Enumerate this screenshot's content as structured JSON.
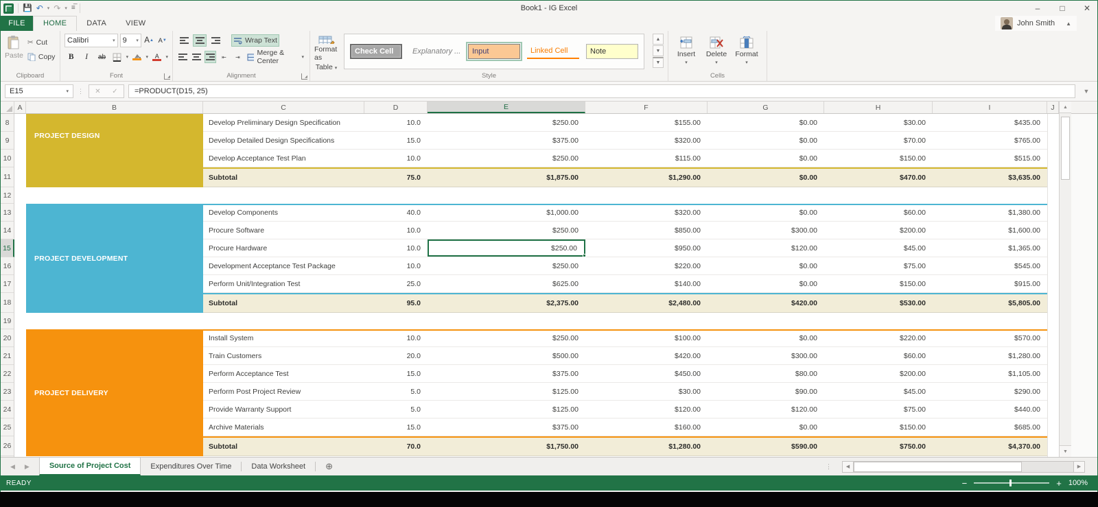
{
  "colors": {
    "accent": "#217346",
    "design": "#d4b72e",
    "development": "#4db5d2",
    "delivery": "#f6920e",
    "subtotal_bg": "#f2edd8"
  },
  "titlebar": {
    "title": "Book1 - IG Excel"
  },
  "tabs": {
    "file": "FILE",
    "items": [
      "HOME",
      "DATA",
      "VIEW"
    ],
    "active": "HOME",
    "user": "John Smith"
  },
  "ribbon": {
    "clipboard": {
      "label": "Clipboard",
      "paste": "Paste",
      "cut": "Cut",
      "copy": "Copy"
    },
    "font": {
      "label": "Font",
      "family": "Calibri",
      "size": "9",
      "bold": "B",
      "italic": "I",
      "strike": "ab"
    },
    "alignment": {
      "label": "Alignment",
      "wrap_text": "Wrap Text",
      "merge_center": "Merge & Center"
    },
    "style": {
      "label": "Style",
      "format_as_table_1": "Format as",
      "format_as_table_2": "Table",
      "gallery": [
        "Check Cell",
        "Explanatory ...",
        "Input",
        "Linked Cell",
        "Note"
      ]
    },
    "cells": {
      "label": "Cells",
      "insert": "Insert",
      "delete": "Delete",
      "format": "Format"
    }
  },
  "formula_bar": {
    "name_box": "E15",
    "formula": "=PRODUCT(D15, 25)"
  },
  "grid": {
    "columns": [
      "A",
      "B",
      "C",
      "D",
      "E",
      "F",
      "G",
      "H",
      "I",
      "J"
    ],
    "selected_column": "E",
    "selected_row": 15,
    "selected_cell": "E15",
    "sections": [
      {
        "name": "PROJECT DESIGN",
        "color_key": "design",
        "top_border": false,
        "spacer_row": 12,
        "rows": [
          [
            8,
            "Develop Preliminary Design Specification",
            "10.0",
            "$250.00",
            "$155.00",
            "$0.00",
            "$30.00",
            "$435.00"
          ],
          [
            9,
            "Develop Detailed Design Specifications",
            "15.0",
            "$375.00",
            "$320.00",
            "$0.00",
            "$70.00",
            "$765.00"
          ],
          [
            10,
            "Develop Acceptance Test Plan",
            "10.0",
            "$250.00",
            "$115.00",
            "$0.00",
            "$150.00",
            "$515.00"
          ]
        ],
        "subtotal": [
          11,
          "Subtotal",
          "75.0",
          "$1,875.00",
          "$1,290.00",
          "$0.00",
          "$470.00",
          "$3,635.00"
        ]
      },
      {
        "name": "PROJECT DEVELOPMENT",
        "color_key": "development",
        "top_border": true,
        "spacer_row": 19,
        "rows": [
          [
            13,
            "Develop Components",
            "40.0",
            "$1,000.00",
            "$320.00",
            "$0.00",
            "$60.00",
            "$1,380.00"
          ],
          [
            14,
            "Procure Software",
            "10.0",
            "$250.00",
            "$850.00",
            "$300.00",
            "$200.00",
            "$1,600.00"
          ],
          [
            15,
            "Procure Hardware",
            "10.0",
            "$250.00",
            "$950.00",
            "$120.00",
            "$45.00",
            "$1,365.00"
          ],
          [
            16,
            "Development Acceptance Test Package",
            "10.0",
            "$250.00",
            "$220.00",
            "$0.00",
            "$75.00",
            "$545.00"
          ],
          [
            17,
            "Perform Unit/Integration Test",
            "25.0",
            "$625.00",
            "$140.00",
            "$0.00",
            "$150.00",
            "$915.00"
          ]
        ],
        "subtotal": [
          18,
          "Subtotal",
          "95.0",
          "$2,375.00",
          "$2,480.00",
          "$420.00",
          "$530.00",
          "$5,805.00"
        ]
      },
      {
        "name": "PROJECT DELIVERY",
        "color_key": "delivery",
        "top_border": true,
        "spacer_row": null,
        "rows": [
          [
            20,
            "Install System",
            "10.0",
            "$250.00",
            "$100.00",
            "$0.00",
            "$220.00",
            "$570.00"
          ],
          [
            21,
            "Train Customers",
            "20.0",
            "$500.00",
            "$420.00",
            "$300.00",
            "$60.00",
            "$1,280.00"
          ],
          [
            22,
            "Perform Acceptance Test",
            "15.0",
            "$375.00",
            "$450.00",
            "$80.00",
            "$200.00",
            "$1,105.00"
          ],
          [
            23,
            "Perform Post Project Review",
            "5.0",
            "$125.00",
            "$30.00",
            "$90.00",
            "$45.00",
            "$290.00"
          ],
          [
            24,
            "Provide Warranty Support",
            "5.0",
            "$125.00",
            "$120.00",
            "$120.00",
            "$75.00",
            "$440.00"
          ],
          [
            25,
            "Archive Materials",
            "15.0",
            "$375.00",
            "$160.00",
            "$0.00",
            "$150.00",
            "$685.00"
          ]
        ],
        "subtotal": [
          26,
          "Subtotal",
          "70.0",
          "$1,750.00",
          "$1,280.00",
          "$590.00",
          "$750.00",
          "$4,370.00"
        ]
      }
    ]
  },
  "sheet_bar": {
    "tabs": [
      "Source of Project Cost",
      "Expenditures Over Time",
      "Data Worksheet"
    ],
    "active": "Source of Project Cost"
  },
  "status_bar": {
    "status": "READY",
    "zoom": "100%"
  }
}
